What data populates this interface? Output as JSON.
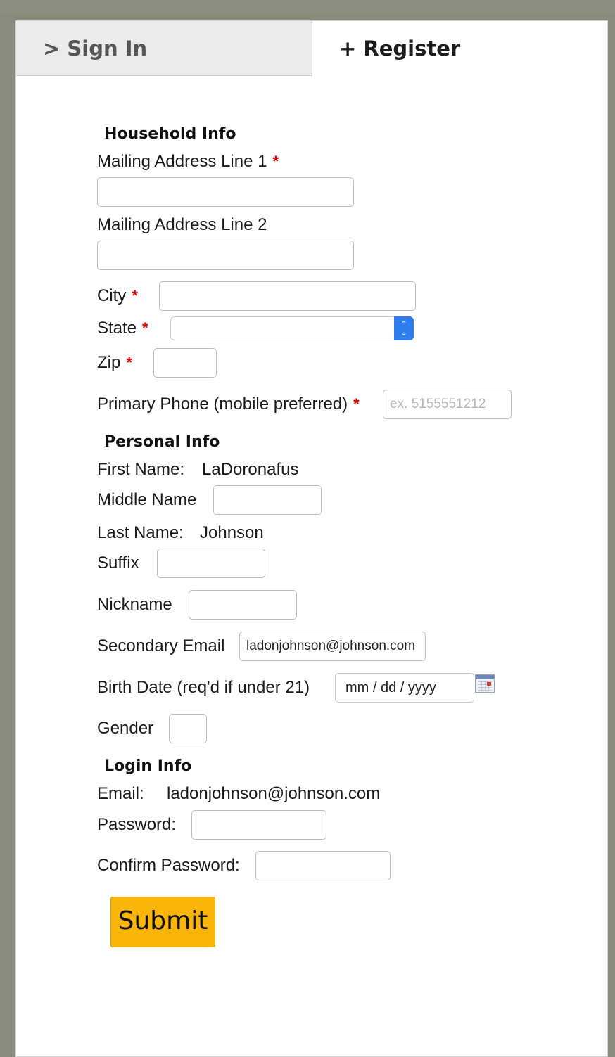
{
  "tabs": {
    "signin_label": "> Sign In",
    "register_label": "+ Register"
  },
  "household": {
    "heading": "Household Info",
    "address1_label": "Mailing Address Line 1",
    "address2_label": "Mailing Address Line 2",
    "city_label": "City",
    "state_label": "State",
    "state_value": "",
    "zip_label": "Zip",
    "phone_label": "Primary Phone (mobile preferred)",
    "phone_placeholder": "ex. 5155551212",
    "required_mark": "*"
  },
  "personal": {
    "heading": "Personal Info",
    "first_name_label": "First Name:",
    "first_name_value": "LaDoronafus",
    "middle_name_label": "Middle Name",
    "last_name_label": "Last Name:",
    "last_name_value": "Johnson",
    "suffix_label": "Suffix",
    "nickname_label": "Nickname",
    "secondary_email_label": "Secondary Email",
    "secondary_email_value": "ladonjohnson@johnson.com",
    "birth_date_label": "Birth Date (req'd if under 21)",
    "birth_date_placeholder": "mm / dd / yyyy",
    "gender_label": "Gender"
  },
  "login": {
    "heading": "Login Info",
    "email_label": "Email:",
    "email_value": "ladonjohnson@johnson.com",
    "password_label": "Password:",
    "confirm_password_label": "Confirm Password:"
  },
  "submit_label": "Submit",
  "colors": {
    "accent_submit": "#f9b50a",
    "required": "#e00000",
    "select_arrow": "#2f7ef0"
  },
  "icons": {
    "calendar": "calendar-icon",
    "select_arrows": "chevron-updown-icon"
  }
}
